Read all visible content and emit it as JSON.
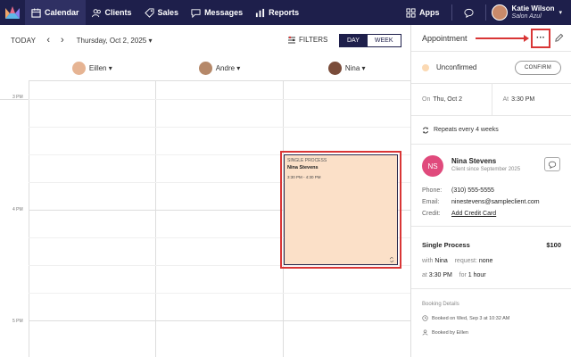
{
  "nav": {
    "items": [
      {
        "label": "Calendar",
        "icon": "calendar-icon",
        "active": true
      },
      {
        "label": "Clients",
        "icon": "users-icon"
      },
      {
        "label": "Sales",
        "icon": "tag-icon"
      },
      {
        "label": "Messages",
        "icon": "chat-icon"
      },
      {
        "label": "Reports",
        "icon": "bar-chart-icon"
      }
    ],
    "apps_label": "Apps",
    "user_name": "Katie Wilson",
    "user_sub": "Salon Azul"
  },
  "toolbar": {
    "today": "TODAY",
    "date": "Thursday, Oct 2, 2025 ▾",
    "filters": "FILTERS",
    "view_day": "DAY",
    "view_week": "WEEK"
  },
  "staff": [
    {
      "name": "Eillen ▾"
    },
    {
      "name": "Andre ▾"
    },
    {
      "name": "Nina ▾"
    }
  ],
  "hours": [
    "3 PM",
    "4 PM",
    "5 PM"
  ],
  "appointment": {
    "type": "SINGLE PROCESS",
    "client": "Nina Stevens",
    "time": "3:30 PM - 4:30 PM"
  },
  "panel": {
    "title": "Appointment",
    "more": "···",
    "status": "Unconfirmed",
    "confirm": "CONFIRM",
    "on_label": "On",
    "on_value": "Thu, Oct 2",
    "at_label": "At",
    "at_value": "3:30 PM",
    "repeats": "Repeats every 4 weeks",
    "client": {
      "initials": "NS",
      "name": "Nina Stevens",
      "since": "Client since September 2025",
      "phone_label": "Phone:",
      "phone": "(310) 555-5555",
      "email_label": "Email:",
      "email": "ninestevens@sampleclient.com",
      "credit_label": "Credit:",
      "credit": "Add Credit Card"
    },
    "service": {
      "name": "Single Process",
      "price": "$100",
      "with_label": "with",
      "with_value": "Nina",
      "request_label": "request:",
      "request_value": "none",
      "at_label": "at",
      "at_value": "3:30 PM",
      "for_label": "for",
      "for_value": "1 hour"
    },
    "booking": {
      "title": "Booking Details",
      "booked_on": "Booked on Wed, Sep 3 at 10:32 AM",
      "booked_by": "Booked by Eillen"
    }
  }
}
